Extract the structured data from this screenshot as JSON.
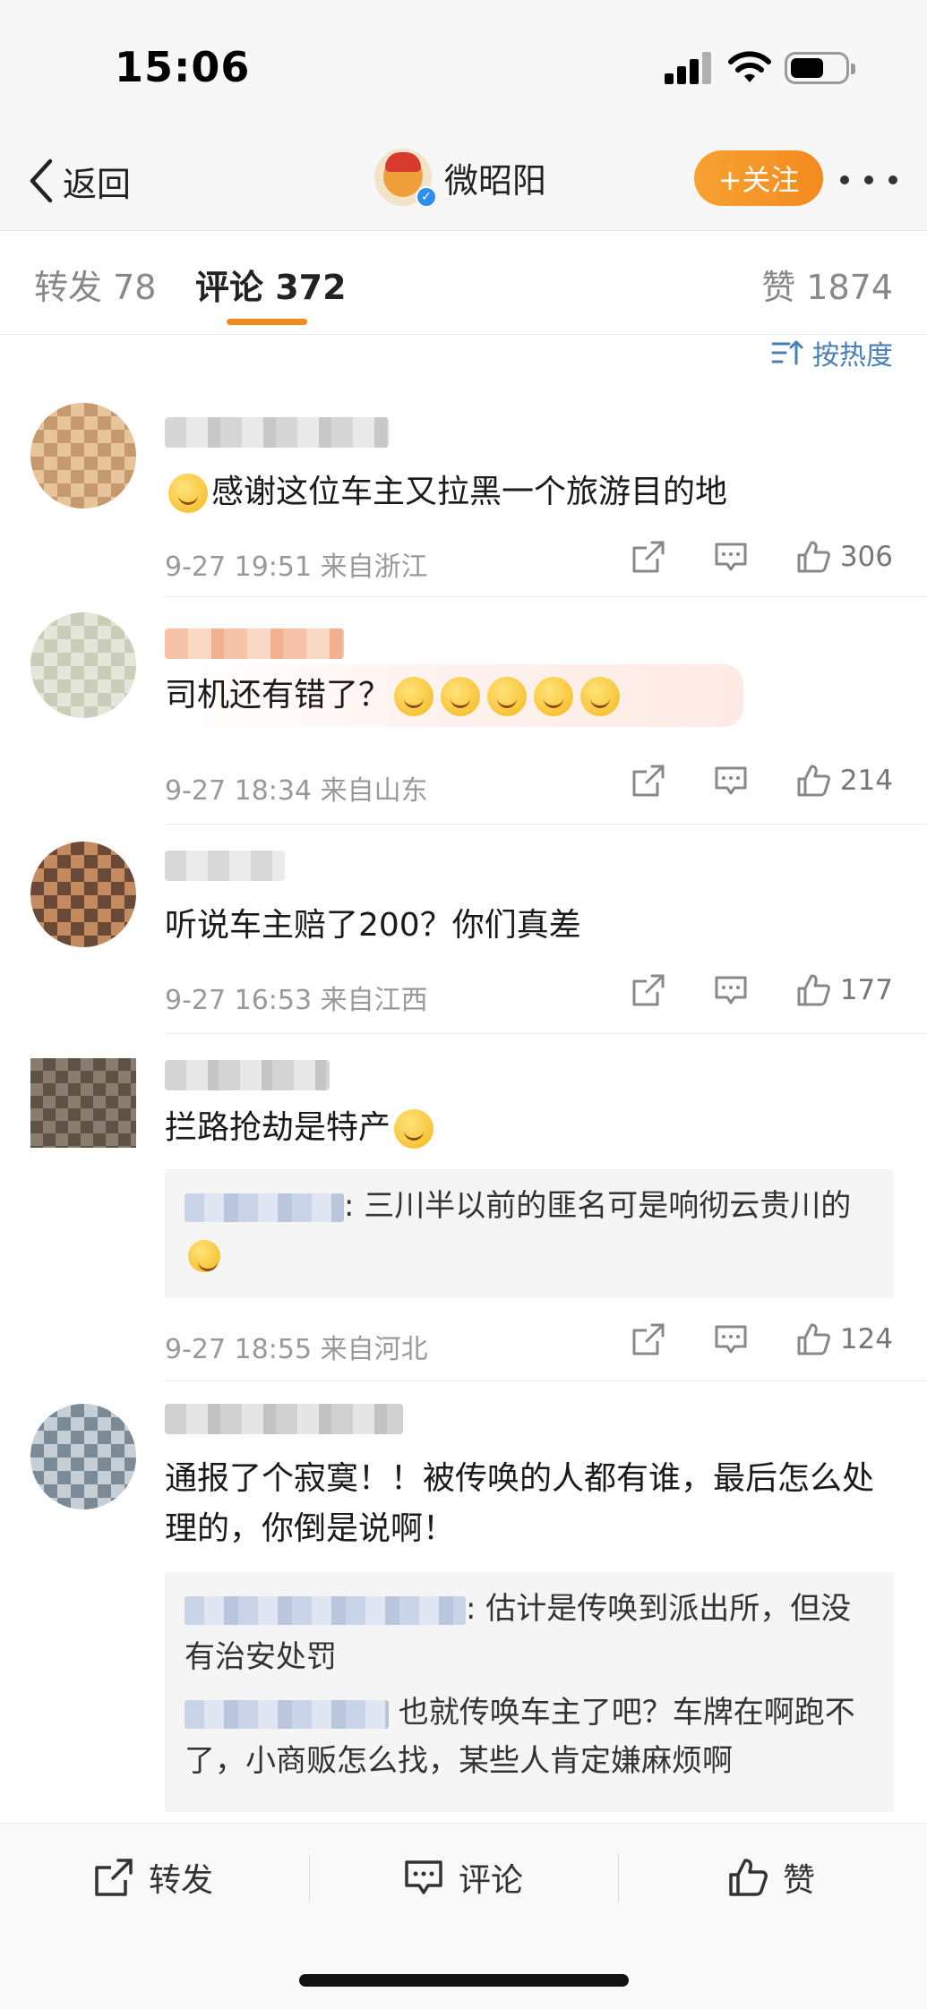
{
  "status_bar": {
    "time": "15:06"
  },
  "nav": {
    "back_label": "返回",
    "account_name": "微昭阳",
    "follow_label": "+关注"
  },
  "tabs": [
    {
      "label": "转发 78"
    },
    {
      "label": "评论 372"
    },
    {
      "label": "赞 1874"
    }
  ],
  "sort_label": "按热度",
  "comments": [
    {
      "text": "感谢这位车主又拉黑一个旅游目的地",
      "meta": "9-27 19:51  来自浙江",
      "likes": "306"
    },
    {
      "text": "司机还有错了？",
      "meta": "9-27 18:34  来自山东",
      "likes": "214"
    },
    {
      "text": "听说车主赔了200？你们真差",
      "meta": "9-27 16:53  来自江西",
      "likes": "177"
    },
    {
      "text": "拦路抢劫是特产",
      "meta": "9-27 18:55  来自河北",
      "likes": "124",
      "replies": [
        {
          "text": ": 三川半以前的匪名可是响彻云贵川的"
        }
      ]
    },
    {
      "text": "通报了个寂寞！！被传唤的人都有谁，最后怎么处理的，你倒是说啊！",
      "meta": "",
      "likes": "",
      "replies": [
        {
          "text": ": 估计是传唤到派出所，但没有治安处罚"
        },
        {
          "text": " 也就传唤车主了吧？车牌在啊跑不了，小商贩怎么找，某些人肯定嫌麻烦啊"
        }
      ]
    }
  ],
  "bottom_bar": {
    "repost_label": "转发",
    "comment_label": "评论",
    "like_label": "赞"
  },
  "colors": {
    "accent_orange": "#f48a1e",
    "link_blue": "#4a7fb5",
    "meta_gray": "#999999"
  }
}
